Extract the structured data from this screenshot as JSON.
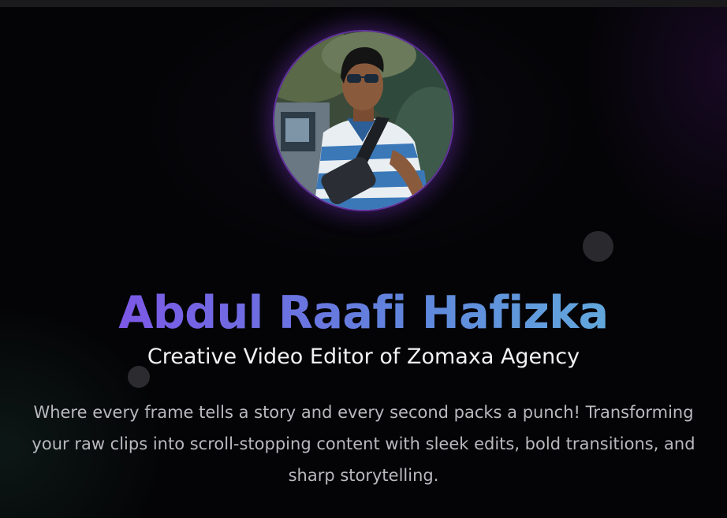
{
  "profile": {
    "name": "Abdul Raafi Hafizka",
    "title": "Creative Video Editor of Zomaxa Agency",
    "description": "Where every frame tells a story and every second packs a punch! Transforming your raw clips into scroll-stopping content with sleek edits, bold transitions, and sharp storytelling.",
    "avatar_icon": "profile-photo"
  },
  "colors": {
    "name_gradient_start": "#7c58e6",
    "name_gradient_end": "#62a8dc",
    "avatar_glow": "#8c3ce6",
    "background": "#040406"
  }
}
